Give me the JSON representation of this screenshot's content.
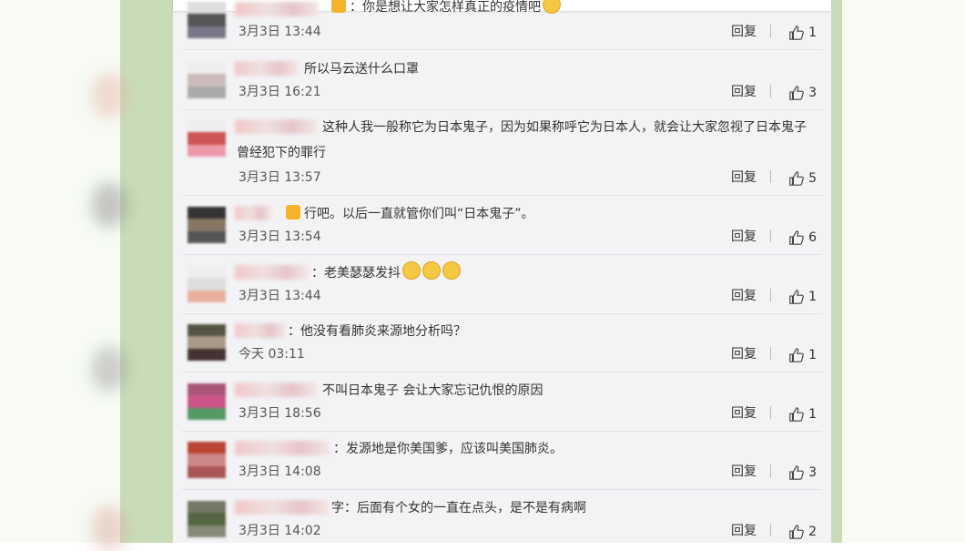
{
  "reply_label": "回复",
  "comments": [
    {
      "text": "：你是想让大家怎样真正的疫情吧",
      "time": "3月3日 13:44",
      "likes": "1"
    },
    {
      "text": "所以马云送什么口罩",
      "time": "3月3日 16:21",
      "likes": "3"
    },
    {
      "text": "这种人我一般称它为日本鬼子，因为如果称呼它为日本人，就会让大家忽视了日本鬼子曾经犯下的罪行",
      "time": "3月3日 13:57",
      "likes": "5"
    },
    {
      "text": "行吧。以后一直就管你们叫“日本鬼子”。",
      "time": "3月3日 13:54",
      "likes": "6"
    },
    {
      "text": "：老美瑟瑟发抖",
      "time": "3月3日 13:44",
      "likes": "1"
    },
    {
      "text": "：他没有看肺炎来源地分析吗？",
      "time": "今天 03:11",
      "likes": "1"
    },
    {
      "text": "不叫日本鬼子 会让大家忘记仇恨的原因",
      "time": "3月3日 18:56",
      "likes": "1"
    },
    {
      "text": "：发源地是你美国爹，应该叫美国肺炎。",
      "time": "3月3日 14:08",
      "likes": "3"
    },
    {
      "text": "字：后面有个女的一直在点头，是不是有病啊",
      "time": "3月3日 14:02",
      "likes": "2"
    }
  ]
}
